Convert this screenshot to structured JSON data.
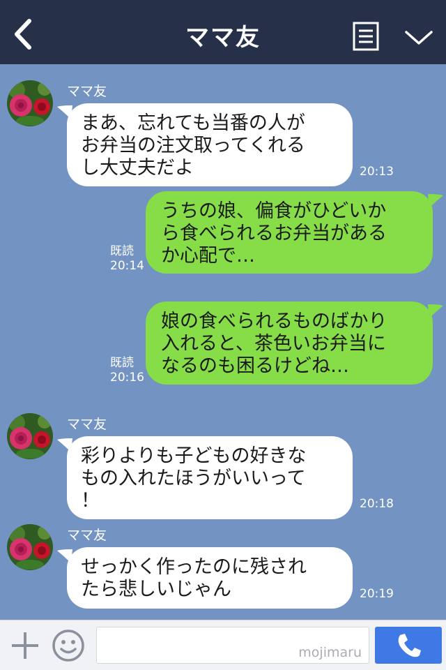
{
  "header": {
    "title": "ママ友"
  },
  "messages": [
    {
      "sender": "ママ友",
      "lines": [
        "まあ、忘れても当番の人が",
        "お弁当の注文取ってくれる",
        "し大丈夫だよ"
      ],
      "time": "20:13"
    },
    {
      "read_label": "既読",
      "lines": [
        "うちの娘、偏食がひどいか",
        "ら食べられるお弁当がある",
        "か心配で…"
      ],
      "time": "20:14"
    },
    {
      "read_label": "既読",
      "lines": [
        "娘の食べられるものばかり",
        "入れると、茶色いお弁当に",
        "なるのも困るけどね…"
      ],
      "time": "20:16"
    },
    {
      "sender": "ママ友",
      "lines": [
        "彩りよりも子どもの好きな",
        "もの入れたほうがいいって",
        "！"
      ],
      "time": "20:18"
    },
    {
      "sender": "ママ友",
      "lines": [
        "せっかく作ったのに残され",
        "たら悲しいじゃん"
      ],
      "time": "20:19"
    }
  ],
  "input": {
    "value": "",
    "watermark": "mojimaru"
  },
  "icons": {
    "back": "chevron-left-icon",
    "menu": "note-menu-icon",
    "expand": "chevron-down-icon",
    "plus": "plus-icon",
    "sticker": "smiley-icon",
    "call": "phone-icon"
  },
  "colors": {
    "header": "#263049",
    "background": "#7393c3",
    "incoming": "#ffffff",
    "outgoing": "#86dd48",
    "call_button": "#3f79e6"
  }
}
